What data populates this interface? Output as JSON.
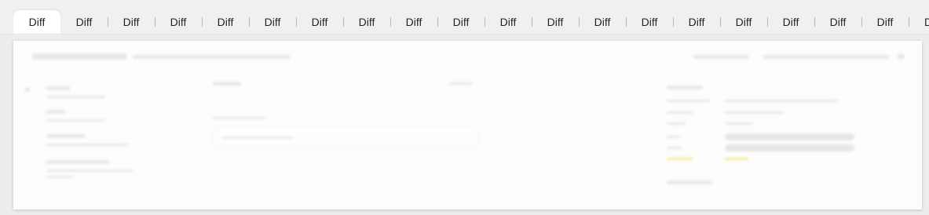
{
  "tabs": [
    {
      "label": "Diff",
      "active": true
    },
    {
      "label": "Diff"
    },
    {
      "label": "Diff"
    },
    {
      "label": "Diff"
    },
    {
      "label": "Diff"
    },
    {
      "label": "Diff"
    },
    {
      "label": "Diff"
    },
    {
      "label": "Diff"
    },
    {
      "label": "Diff"
    },
    {
      "label": "Diff"
    },
    {
      "label": "Diff"
    },
    {
      "label": "Diff"
    },
    {
      "label": "Diff"
    },
    {
      "label": "Diff"
    },
    {
      "label": "Diff"
    },
    {
      "label": "Diff"
    },
    {
      "label": "Diff"
    },
    {
      "label": "Diff"
    },
    {
      "label": "Diff"
    },
    {
      "label": "D"
    }
  ],
  "colors": {
    "accent_highlight": "#f2d94a",
    "tab_text": "#1f2328"
  }
}
